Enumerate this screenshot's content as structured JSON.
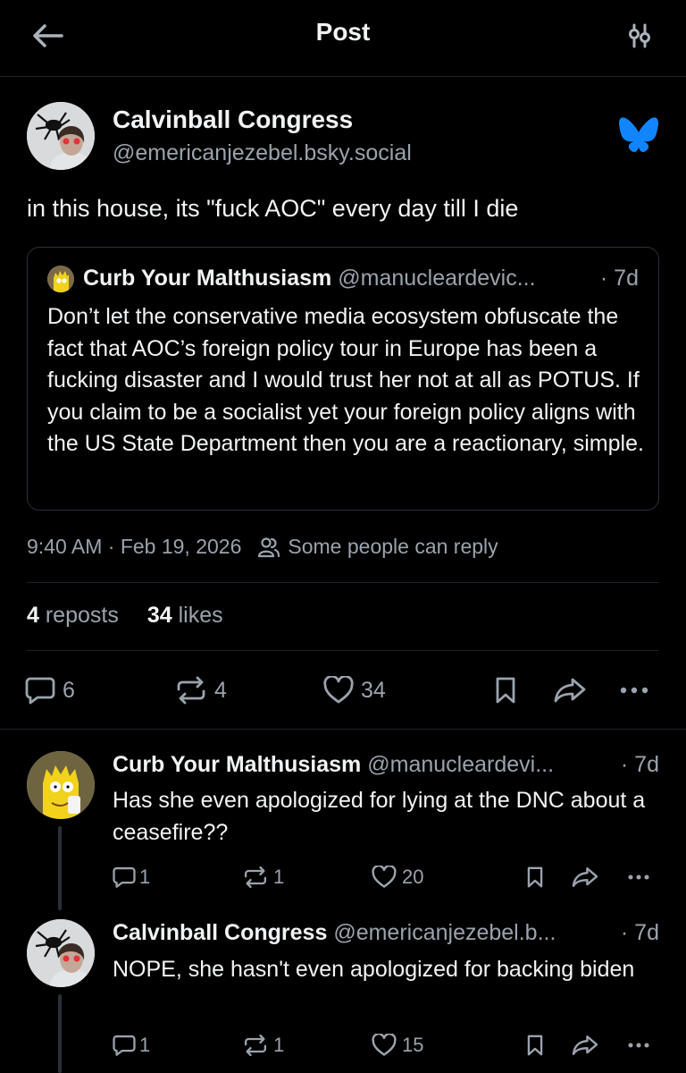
{
  "header": {
    "title": "Post"
  },
  "post": {
    "author_name": "Calvinball Congress",
    "author_handle": "@emericanjezebel.bsky.social",
    "text": "in this house, its \"fuck AOC\" every day till I die",
    "quote": {
      "author_name": "Curb Your Malthusiasm",
      "author_handle": "@manucleardevic...",
      "time": "· 7d",
      "text": "Don’t let the conservative media ecosystem obfuscate the fact that AOC’s foreign policy tour in Europe has been a fucking disaster and I would trust her not at all as POTUS. If you claim to be a socialist yet your foreign policy aligns with the US State Department then you are a reactionary, simple."
    },
    "timestamp": "9:40 AM · Feb 19, 2026",
    "reply_setting": "Some people can reply",
    "reposts_count": "4",
    "reposts_label": "reposts",
    "likes_count": "34",
    "likes_label": "likes",
    "actions": {
      "replies": "6",
      "reposts": "4",
      "likes": "34"
    }
  },
  "replies": [
    {
      "author_name": "Curb Your Malthusiasm",
      "author_handle": "@manucleardevi...",
      "time": "· 7d",
      "text": "Has she even apologized for lying at the DNC about a ceasefire??",
      "replies": "1",
      "reposts": "1",
      "likes": "20"
    },
    {
      "author_name": "Calvinball Congress",
      "author_handle": "@emericanjezebel.b...",
      "time": "· 7d",
      "text": "NOPE, she hasn't even apologized for backing biden",
      "replies": "1",
      "reposts": "1",
      "likes": "15"
    }
  ],
  "colors": {
    "background": "#000000",
    "text": "#f1f3f5",
    "muted": "#9aa3ad",
    "brand": "#1185fe"
  },
  "icons": [
    "back-arrow-icon",
    "thread-settings-icon",
    "bluesky-butterfly-icon",
    "people-icon",
    "comment-icon",
    "repost-icon",
    "heart-icon",
    "bookmark-icon",
    "share-icon",
    "more-icon"
  ]
}
